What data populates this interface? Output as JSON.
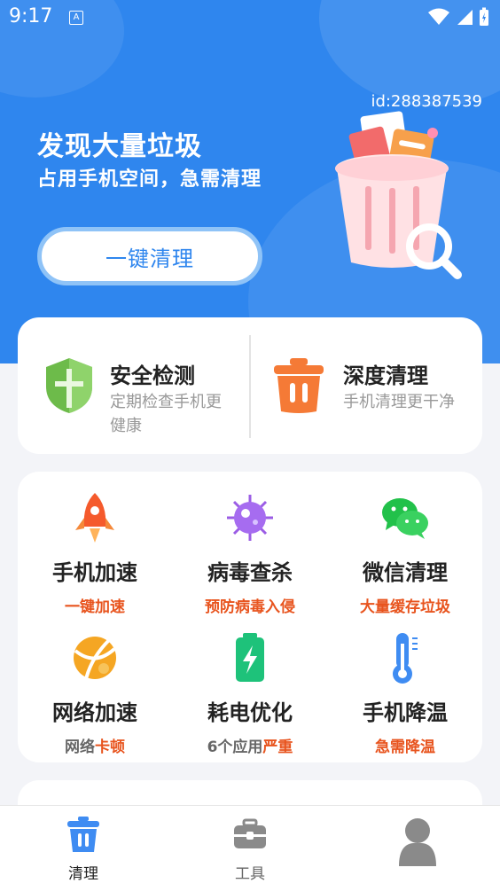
{
  "status_bar": {
    "time": "9:17",
    "a_badge": "A"
  },
  "hero": {
    "user_id": "id:288387539",
    "title": "发现大量垃圾",
    "subtitle": "占用手机空间，急需清理",
    "clean_button": "一键清理"
  },
  "top_features": [
    {
      "title": "安全检测",
      "desc": "定期检查手机更健康"
    },
    {
      "title": "深度清理",
      "desc": "手机清理更干净"
    }
  ],
  "grid": [
    {
      "title": "手机加速",
      "desc": "一键加速",
      "desc_highlight": ""
    },
    {
      "title": "病毒查杀",
      "desc": "预防病毒入侵",
      "desc_highlight": ""
    },
    {
      "title": "微信清理",
      "desc": "大量缓存垃圾",
      "desc_highlight": ""
    },
    {
      "title": "网络加速",
      "desc_prefix": "网络",
      "desc_highlight": "卡顿"
    },
    {
      "title": "耗电优化",
      "desc_prefix": "6个应用",
      "desc_highlight": "严重"
    },
    {
      "title": "手机降温",
      "desc": "急需降温",
      "desc_highlight": ""
    }
  ],
  "tabs": [
    {
      "label": "清理",
      "icon": "trash-icon",
      "active": true
    },
    {
      "label": "工具",
      "icon": "toolbox-icon",
      "active": false
    },
    {
      "label": "",
      "icon": "user-icon",
      "active": false
    }
  ],
  "colors": {
    "primary": "#2f86ee",
    "accent_orange": "#e8541e",
    "shield_green": "#6dbb4a",
    "trash_orange": "#f57a36"
  }
}
